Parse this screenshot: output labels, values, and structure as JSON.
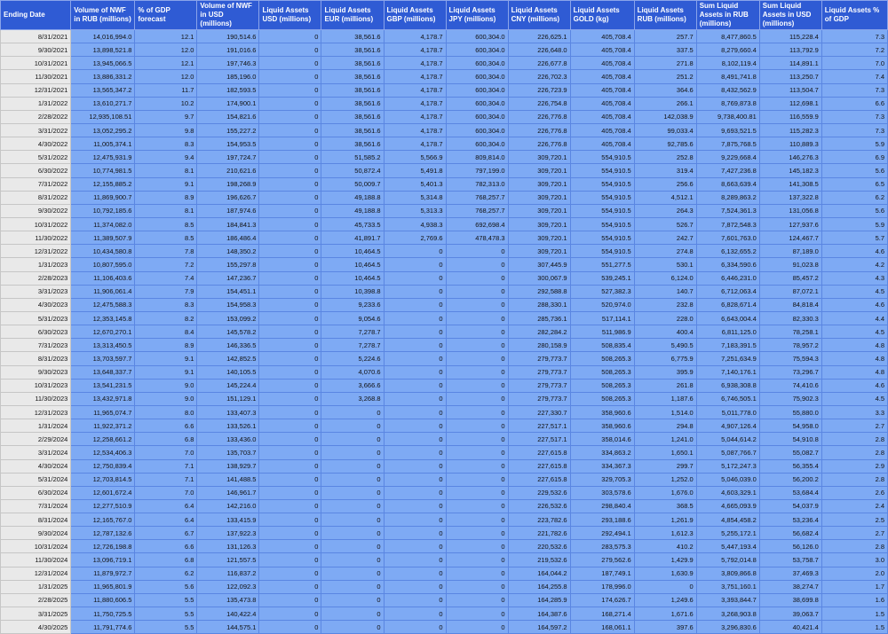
{
  "columns": [
    "Ending Date",
    "Volume of NWF in RUB (millions)",
    "% of GDP forecast",
    "Volume of NWF in USD (millions)",
    "Liquid Assets USD (millions)",
    "Liquid Assets EUR (millions)",
    "Liquid Assets GBP (millions)",
    "Liquid Assets JPY (millions)",
    "Liquid Assets CNY (millions)",
    "Liquid Assets GOLD (kg)",
    "Liquid Assets RUB (millions)",
    "Sum Liquid Assets in RUB (millions)",
    "Sum Liquid Assets in USD (millions)",
    "Liquid Assets % of GDP"
  ],
  "rows": [
    [
      "8/31/2021",
      "14,016,994.0",
      "12.1",
      "190,514.6",
      "0",
      "38,561.6",
      "4,178.7",
      "600,304.0",
      "226,625.1",
      "405,708.4",
      "257.7",
      "8,477,860.5",
      "115,228.4",
      "7.3"
    ],
    [
      "9/30/2021",
      "13,898,521.8",
      "12.0",
      "191,016.6",
      "0",
      "38,561.6",
      "4,178.7",
      "600,304.0",
      "226,648.0",
      "405,708.4",
      "337.5",
      "8,279,660.4",
      "113,792.9",
      "7.2"
    ],
    [
      "10/31/2021",
      "13,945,066.5",
      "12.1",
      "197,746.3",
      "0",
      "38,561.6",
      "4,178.7",
      "600,304.0",
      "226,677.8",
      "405,708.4",
      "271.8",
      "8,102,119.4",
      "114,891.1",
      "7.0"
    ],
    [
      "11/30/2021",
      "13,886,331.2",
      "12.0",
      "185,196.0",
      "0",
      "38,561.6",
      "4,178.7",
      "600,304.0",
      "226,702.3",
      "405,708.4",
      "251.2",
      "8,491,741.8",
      "113,250.7",
      "7.4"
    ],
    [
      "12/31/2021",
      "13,565,347.2",
      "11.7",
      "182,593.5",
      "0",
      "38,561.6",
      "4,178.7",
      "600,304.0",
      "226,723.9",
      "405,708.4",
      "364.6",
      "8,432,562.9",
      "113,504.7",
      "7.3"
    ],
    [
      "1/31/2022",
      "13,610,271.7",
      "10.2",
      "174,900.1",
      "0",
      "38,561.6",
      "4,178.7",
      "600,304.0",
      "226,754.8",
      "405,708.4",
      "266.1",
      "8,769,873.8",
      "112,698.1",
      "6.6"
    ],
    [
      "2/28/2022",
      "12,935,108.51",
      "9.7",
      "154,821.6",
      "0",
      "38,561.6",
      "4,178.7",
      "600,304.0",
      "226,776.8",
      "405,708.4",
      "142,038.9",
      "9,738,400.81",
      "116,559.9",
      "7.3"
    ],
    [
      "3/31/2022",
      "13,052,295.2",
      "9.8",
      "155,227.2",
      "0",
      "38,561.6",
      "4,178.7",
      "600,304.0",
      "226,776.8",
      "405,708.4",
      "99,033.4",
      "9,693,521.5",
      "115,282.3",
      "7.3"
    ],
    [
      "4/30/2022",
      "11,005,374.1",
      "8.3",
      "154,953.5",
      "0",
      "38,561.6",
      "4,178.7",
      "600,304.0",
      "226,776.8",
      "405,708.4",
      "92,785.6",
      "7,875,768.5",
      "110,889.3",
      "5.9"
    ],
    [
      "5/31/2022",
      "12,475,931.9",
      "9.4",
      "197,724.7",
      "0",
      "51,585.2",
      "5,566.9",
      "809,814.0",
      "309,720.1",
      "554,910.5",
      "252.8",
      "9,229,668.4",
      "146,276.3",
      "6.9"
    ],
    [
      "6/30/2022",
      "10,774,981.5",
      "8.1",
      "210,621.6",
      "0",
      "50,872.4",
      "5,491.8",
      "797,199.0",
      "309,720.1",
      "554,910.5",
      "319.4",
      "7,427,236.8",
      "145,182.3",
      "5.6"
    ],
    [
      "7/31/2022",
      "12,155,885.2",
      "9.1",
      "198,268.9",
      "0",
      "50,009.7",
      "5,401.3",
      "782,313.0",
      "309,720.1",
      "554,910.5",
      "256.6",
      "8,663,639.4",
      "141,308.5",
      "6.5"
    ],
    [
      "8/31/2022",
      "11,869,900.7",
      "8.9",
      "196,626.7",
      "0",
      "49,188.8",
      "5,314.8",
      "768,257.7",
      "309,720.1",
      "554,910.5",
      "4,512.1",
      "8,289,863.2",
      "137,322.8",
      "6.2"
    ],
    [
      "9/30/2022",
      "10,792,185.6",
      "8.1",
      "187,974.6",
      "0",
      "49,188.8",
      "5,313.3",
      "768,257.7",
      "309,720.1",
      "554,910.5",
      "264.3",
      "7,524,361.3",
      "131,056.8",
      "5.6"
    ],
    [
      "10/31/2022",
      "11,374,082.0",
      "8.5",
      "184,841.3",
      "0",
      "45,733.5",
      "4,938.3",
      "692,698.4",
      "309,720.1",
      "554,910.5",
      "526.7",
      "7,872,548.3",
      "127,937.6",
      "5.9"
    ],
    [
      "11/30/2022",
      "11,389,507.9",
      "8.5",
      "186,486.4",
      "0",
      "41,891.7",
      "2,769.6",
      "478,478.3",
      "309,720.1",
      "554,910.5",
      "242.7",
      "7,601,763.0",
      "124,467.7",
      "5.7"
    ],
    [
      "12/31/2022",
      "10,434,580.8",
      "7.8",
      "148,350.2",
      "0",
      "10,464.5",
      "0",
      "0",
      "309,720.1",
      "554,910.5",
      "274.8",
      "6,132,655.2",
      "87,189.0",
      "4.6"
    ],
    [
      "1/31/2023",
      "10,807,595.0",
      "7.2",
      "155,297.8",
      "0",
      "10,464.5",
      "0",
      "0",
      "307,445.9",
      "551,277.5",
      "530.1",
      "6,334,590.6",
      "91,023.8",
      "4.2"
    ],
    [
      "2/28/2023",
      "11,106,403.6",
      "7.4",
      "147,236.7",
      "0",
      "10,464.5",
      "0",
      "0",
      "300,067.9",
      "539,245.1",
      "6,124.0",
      "6,446,231.0",
      "85,457.2",
      "4.3"
    ],
    [
      "3/31/2023",
      "11,906,061.4",
      "7.9",
      "154,451.1",
      "0",
      "10,398.8",
      "0",
      "0",
      "292,588.8",
      "527,382.3",
      "140.7",
      "6,712,063.4",
      "87,072.1",
      "4.5"
    ],
    [
      "4/30/2023",
      "12,475,588.3",
      "8.3",
      "154,958.3",
      "0",
      "9,233.6",
      "0",
      "0",
      "288,330.1",
      "520,974.0",
      "232.8",
      "6,828,671.4",
      "84,818.4",
      "4.6"
    ],
    [
      "5/31/2023",
      "12,353,145.8",
      "8.2",
      "153,099.2",
      "0",
      "9,054.6",
      "0",
      "0",
      "285,736.1",
      "517,114.1",
      "228.0",
      "6,643,004.4",
      "82,330.3",
      "4.4"
    ],
    [
      "6/30/2023",
      "12,670,270.1",
      "8.4",
      "145,578.2",
      "0",
      "7,278.7",
      "0",
      "0",
      "282,284.2",
      "511,986.9",
      "400.4",
      "6,811,125.0",
      "78,258.1",
      "4.5"
    ],
    [
      "7/31/2023",
      "13,313,450.5",
      "8.9",
      "146,336.5",
      "0",
      "7,278.7",
      "0",
      "0",
      "280,158.9",
      "508,835.4",
      "5,490.5",
      "7,183,391.5",
      "78,957.2",
      "4.8"
    ],
    [
      "8/31/2023",
      "13,703,597.7",
      "9.1",
      "142,852.5",
      "0",
      "5,224.6",
      "0",
      "0",
      "279,773.7",
      "508,265.3",
      "6,775.9",
      "7,251,634.9",
      "75,594.3",
      "4.8"
    ],
    [
      "9/30/2023",
      "13,648,337.7",
      "9.1",
      "140,105.5",
      "0",
      "4,070.6",
      "0",
      "0",
      "279,773.7",
      "508,265.3",
      "395.9",
      "7,140,176.1",
      "73,296.7",
      "4.8"
    ],
    [
      "10/31/2023",
      "13,541,231.5",
      "9.0",
      "145,224.4",
      "0",
      "3,666.6",
      "0",
      "0",
      "279,773.7",
      "508,265.3",
      "261.8",
      "6,938,308.8",
      "74,410.6",
      "4.6"
    ],
    [
      "11/30/2023",
      "13,432,971.8",
      "9.0",
      "151,129.1",
      "0",
      "3,268.8",
      "0",
      "0",
      "279,773.7",
      "508,265.3",
      "1,187.6",
      "6,746,505.1",
      "75,902.3",
      "4.5"
    ],
    [
      "12/31/2023",
      "11,965,074.7",
      "8.0",
      "133,407.3",
      "0",
      "0",
      "0",
      "0",
      "227,330.7",
      "358,960.6",
      "1,514.0",
      "5,011,778.0",
      "55,880.0",
      "3.3"
    ],
    [
      "1/31/2024",
      "11,922,371.2",
      "6.6",
      "133,526.1",
      "0",
      "0",
      "0",
      "0",
      "227,517.1",
      "358,960.6",
      "294.8",
      "4,907,126.4",
      "54,958.0",
      "2.7"
    ],
    [
      "2/29/2024",
      "12,258,661.2",
      "6.8",
      "133,436.0",
      "0",
      "0",
      "0",
      "0",
      "227,517.1",
      "358,014.6",
      "1,241.0",
      "5,044,614.2",
      "54,910.8",
      "2.8"
    ],
    [
      "3/31/2024",
      "12,534,406.3",
      "7.0",
      "135,703.7",
      "0",
      "0",
      "0",
      "0",
      "227,615.8",
      "334,863.2",
      "1,650.1",
      "5,087,766.7",
      "55,082.7",
      "2.8"
    ],
    [
      "4/30/2024",
      "12,750,839.4",
      "7.1",
      "138,929.7",
      "0",
      "0",
      "0",
      "0",
      "227,615.8",
      "334,367.3",
      "299.7",
      "5,172,247.3",
      "56,355.4",
      "2.9"
    ],
    [
      "5/31/2024",
      "12,703,814.5",
      "7.1",
      "141,488.5",
      "0",
      "0",
      "0",
      "0",
      "227,615.8",
      "329,705.3",
      "1,252.0",
      "5,046,039.0",
      "56,200.2",
      "2.8"
    ],
    [
      "6/30/2024",
      "12,601,672.4",
      "7.0",
      "146,961.7",
      "0",
      "0",
      "0",
      "0",
      "229,532.6",
      "303,578.6",
      "1,676.0",
      "4,603,329.1",
      "53,684.4",
      "2.6"
    ],
    [
      "7/31/2024",
      "12,277,510.9",
      "6.4",
      "142,216.0",
      "0",
      "0",
      "0",
      "0",
      "226,532.6",
      "298,840.4",
      "368.5",
      "4,665,093.9",
      "54,037.9",
      "2.4"
    ],
    [
      "8/31/2024",
      "12,165,767.0",
      "6.4",
      "133,415.9",
      "0",
      "0",
      "0",
      "0",
      "223,782.6",
      "293,188.6",
      "1,261.9",
      "4,854,458.2",
      "53,236.4",
      "2.5"
    ],
    [
      "9/30/2024",
      "12,787,132.6",
      "6.7",
      "137,922.3",
      "0",
      "0",
      "0",
      "0",
      "221,782.6",
      "292,494.1",
      "1,612.3",
      "5,255,172.1",
      "56,682.4",
      "2.7"
    ],
    [
      "10/31/2024",
      "12,726,198.8",
      "6.6",
      "131,126.3",
      "0",
      "0",
      "0",
      "0",
      "220,532.6",
      "283,575.3",
      "410.2",
      "5,447,193.4",
      "56,126.0",
      "2.8"
    ],
    [
      "11/30/2024",
      "13,096,719.1",
      "6.8",
      "121,557.5",
      "0",
      "0",
      "0",
      "0",
      "219,532.6",
      "279,562.6",
      "1,429.9",
      "5,792,014.8",
      "53,758.7",
      "3.0"
    ],
    [
      "12/31/2024",
      "11,879,972.7",
      "6.2",
      "116,837.2",
      "0",
      "0",
      "0",
      "0",
      "164,044.2",
      "187,749.1",
      "1,630.9",
      "3,809,866.8",
      "37,469.3",
      "2.0"
    ],
    [
      "1/31/2025",
      "11,965,801.9",
      "5.6",
      "122,092.3",
      "0",
      "0",
      "0",
      "0",
      "164,255.8",
      "178,996.0",
      "0",
      "3,751,160.1",
      "38,274.7",
      "1.7"
    ],
    [
      "2/28/2025",
      "11,880,606.5",
      "5.5",
      "135,473.8",
      "0",
      "0",
      "0",
      "0",
      "164,285.9",
      "174,626.7",
      "1,249.6",
      "3,393,844.7",
      "38,699.8",
      "1.6"
    ],
    [
      "3/31/2025",
      "11,750,725.5",
      "5.5",
      "140,422.4",
      "0",
      "0",
      "0",
      "0",
      "164,387.6",
      "168,271.4",
      "1,671.6",
      "3,268,903.8",
      "39,063.7",
      "1.5"
    ],
    [
      "4/30/2025",
      "11,791,774.6",
      "5.5",
      "144,575.1",
      "0",
      "0",
      "0",
      "0",
      "164,597.2",
      "168,061.1",
      "397.6",
      "3,296,830.6",
      "40,421.4",
      "1.5"
    ]
  ]
}
